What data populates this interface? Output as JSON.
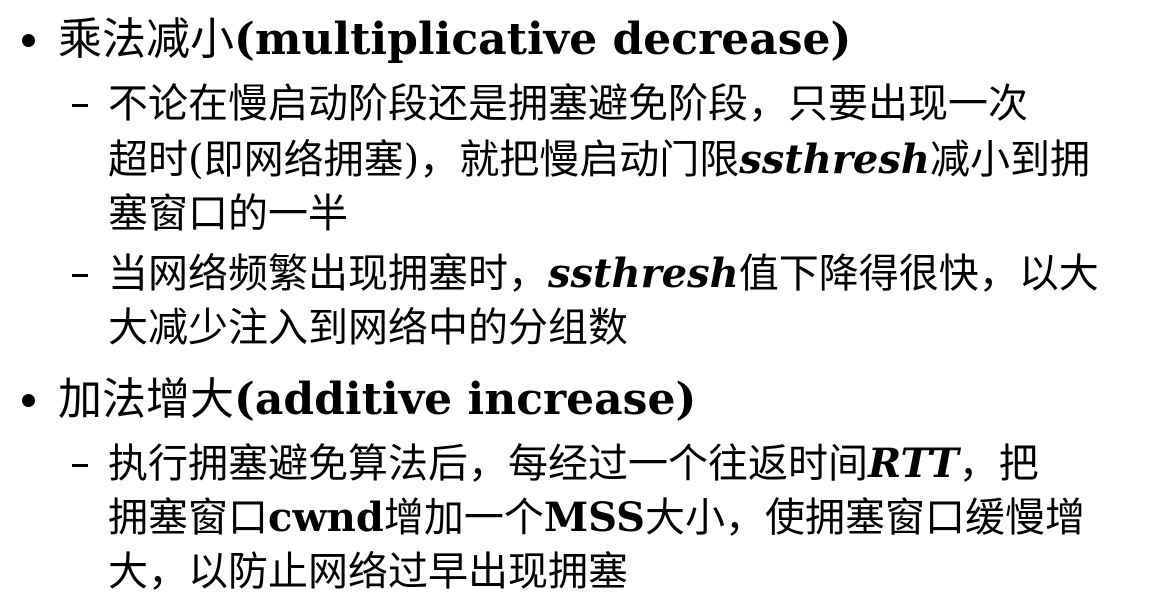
{
  "items": [
    {
      "heading_cn": "乘法减小",
      "heading_en": "(multiplicative decrease)",
      "subs": [
        {
          "lines": [
            [
              "不论在慢启动阶段还是拥塞避免阶段，只要出现一次"
            ],
            [
              "超时(即网络拥塞)，就把慢启动门限",
              "ssthresh",
              "减小到拥"
            ],
            [
              "塞窗口的一半"
            ]
          ]
        },
        {
          "lines": [
            [
              "当网络频繁出现拥塞时，",
              "ssthresh",
              "值下降得很快，以大"
            ],
            [
              "大减少注入到网络中的分组数"
            ]
          ]
        }
      ]
    },
    {
      "heading_cn": "加法增大",
      "heading_en": "(additive increase)",
      "subs": [
        {
          "lines": [
            [
              "执行拥塞避免算法后，每经过一个往返时间",
              "RTT",
              "，把"
            ],
            [
              "拥塞窗口",
              "cwnd",
              "增加一个",
              "MSS",
              "大小，使拥塞窗口缓慢增"
            ],
            [
              "大，以防止网络过早出现拥塞"
            ]
          ]
        }
      ]
    }
  ]
}
